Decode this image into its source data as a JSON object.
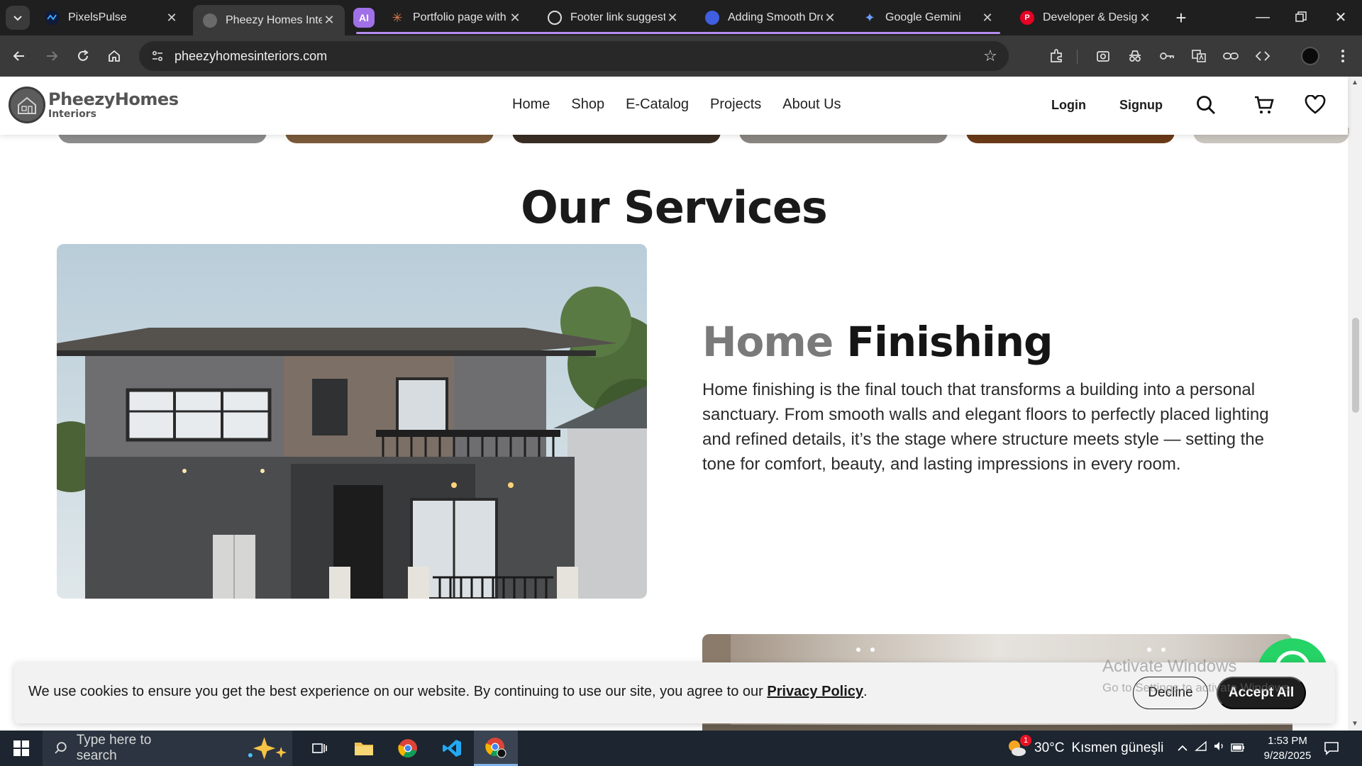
{
  "browser": {
    "tabs": [
      {
        "title": "PixelsPulse",
        "active": false
      },
      {
        "title": "Pheezy Homes Inter",
        "active": true
      },
      {
        "title": "Portfolio page with",
        "active": false
      },
      {
        "title": "Footer link suggesti",
        "active": false
      },
      {
        "title": "Adding Smooth Dro",
        "active": false
      },
      {
        "title": "Google Gemini",
        "active": false
      },
      {
        "title": "Developer & Design",
        "active": false
      }
    ],
    "ai_tab_label": "AI",
    "url": "pheezyhomesinteriors.com"
  },
  "site": {
    "logo": {
      "brand": "PheezyHomes",
      "sub": "Interiors"
    },
    "nav": [
      "Home",
      "Shop",
      "E-Catalog",
      "Projects",
      "About Us"
    ],
    "login": "Login",
    "signup": "Signup"
  },
  "services": {
    "heading": "Our Services",
    "item": {
      "title_light": "Home",
      "title_dark": "Finishing",
      "body": "Home finishing is the final touch that transforms a building into a personal sanctuary. From smooth walls and elegant floors to perfectly placed lighting and refined details, it’s the stage where structure meets style — setting the tone for comfort, beauty, and lasting impressions in every room."
    }
  },
  "cookie": {
    "text": "We use cookies to ensure you get the best experience on our website. By continuing to use our site, you agree to our ",
    "link": "Privacy Policy",
    "after": ".",
    "decline": "Decline",
    "accept": "Accept All"
  },
  "watermark": {
    "line1": "Activate Windows",
    "line2": "Go to Settings to activate Windows."
  },
  "taskbar": {
    "search_placeholder": "Type here to search",
    "weather_temp": "30°C",
    "weather_desc": "Kısmen güneşli",
    "time": "1:53 PM",
    "date": "9/28/2025",
    "weather_badge": "1"
  },
  "colors": {
    "accent_tab_group": "#b58cf0",
    "site_dark": "#151515",
    "whatsapp": "#25d366"
  }
}
